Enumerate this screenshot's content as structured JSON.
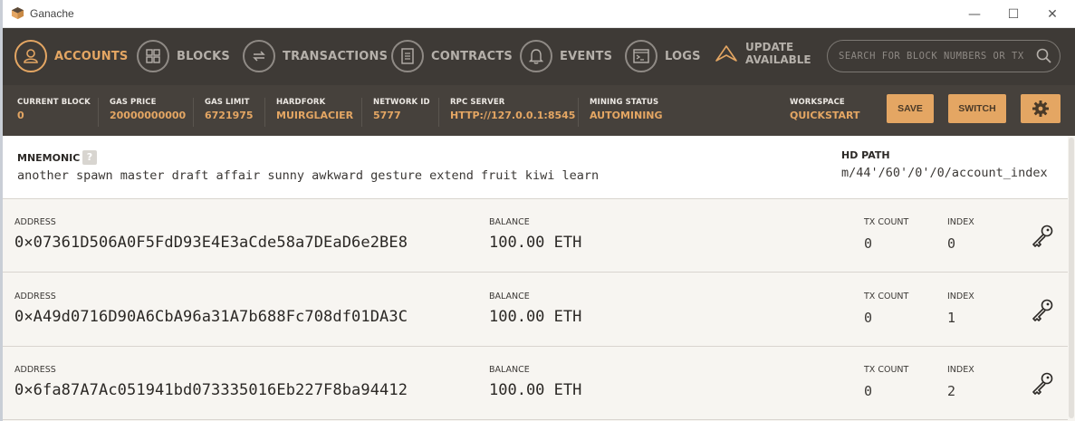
{
  "window": {
    "title": "Ganache",
    "min_glyph": "—",
    "max_glyph": "☐",
    "close_glyph": "✕"
  },
  "nav": {
    "items": [
      {
        "label": "ACCOUNTS",
        "icon": "person-icon",
        "active": true
      },
      {
        "label": "BLOCKS",
        "icon": "grid-icon",
        "active": false
      },
      {
        "label": "TRANSACTIONS",
        "icon": "swap-arrows-icon",
        "active": false
      },
      {
        "label": "CONTRACTS",
        "icon": "document-icon",
        "active": false
      },
      {
        "label": "EVENTS",
        "icon": "bell-icon",
        "active": false
      },
      {
        "label": "LOGS",
        "icon": "terminal-icon",
        "active": false
      }
    ],
    "update": {
      "line1": "UPDATE",
      "line2": "AVAILABLE"
    },
    "search_placeholder": "SEARCH FOR BLOCK NUMBERS OR TX HASHES"
  },
  "status": {
    "current_block": {
      "label": "CURRENT BLOCK",
      "value": "0"
    },
    "gas_price": {
      "label": "GAS PRICE",
      "value": "20000000000"
    },
    "gas_limit": {
      "label": "GAS LIMIT",
      "value": "6721975"
    },
    "hardfork": {
      "label": "HARDFORK",
      "value": "MUIRGLACIER"
    },
    "network_id": {
      "label": "NETWORK ID",
      "value": "5777"
    },
    "rpc_server": {
      "label": "RPC SERVER",
      "value": "HTTP://127.0.0.1:8545"
    },
    "mining_status": {
      "label": "MINING STATUS",
      "value": "AUTOMINING"
    },
    "workspace": {
      "label": "WORKSPACE",
      "value": "QUICKSTART"
    },
    "save_label": "SAVE",
    "switch_label": "SWITCH"
  },
  "mnemonic": {
    "title": "MNEMONIC",
    "help": "?",
    "words": "another spawn master draft affair sunny awkward gesture extend fruit kiwi learn",
    "hd_path_label": "HD PATH",
    "hd_path": "m/44'/60'/0'/0/account_index"
  },
  "account_labels": {
    "address": "ADDRESS",
    "balance": "BALANCE",
    "tx_count": "TX COUNT",
    "index": "INDEX"
  },
  "accounts": [
    {
      "address": "0×07361D506A0F5FdD93E4E3aCde58a7DEaD6e2BE8",
      "balance": "100.00 ETH",
      "tx_count": "0",
      "index": "0"
    },
    {
      "address": "0×A49d0716D90A6CbA96a31A7b688Fc708df01DA3C",
      "balance": "100.00 ETH",
      "tx_count": "0",
      "index": "1"
    },
    {
      "address": "0×6fa87A7Ac051941bd073335016Eb227F8ba94412",
      "balance": "100.00 ETH",
      "tx_count": "0",
      "index": "2"
    }
  ],
  "colors": {
    "accent": "#e4a663",
    "nav_bg": "#3e3a36",
    "status_bg": "#46413c",
    "content_bg": "#f7f5f1"
  }
}
